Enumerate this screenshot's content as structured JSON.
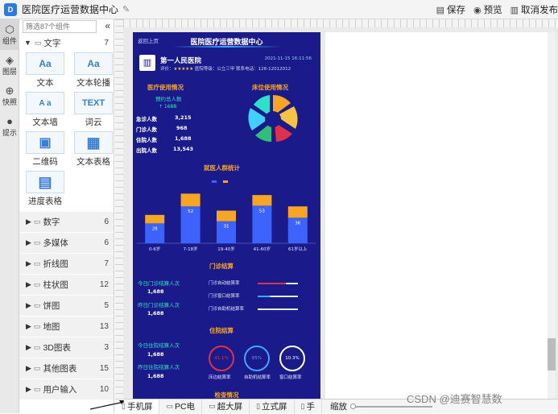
{
  "app": {
    "title": "医院医疗运营数据中心",
    "toolbar": {
      "save": "保存",
      "preview": "预览",
      "cancel_publish": "取消发布"
    }
  },
  "rail": [
    {
      "label": "组件",
      "icon": "cube-icon"
    },
    {
      "label": "图层",
      "icon": "layers-icon"
    },
    {
      "label": "快照",
      "icon": "snapshot-icon"
    },
    {
      "label": "提示",
      "icon": "bulb-icon"
    }
  ],
  "panel": {
    "search_placeholder": "筛选87个组件",
    "text_group": {
      "label": "文字",
      "count": "7"
    },
    "tiles": [
      {
        "label": "文本",
        "glyph": "Aa"
      },
      {
        "label": "文本轮播",
        "glyph": "Aa"
      },
      {
        "label": "文本墙",
        "glyph": "A a"
      },
      {
        "label": "词云",
        "glyph": "TEXT"
      },
      {
        "label": "二维码",
        "glyph": "▣"
      },
      {
        "label": "文本表格",
        "glyph": "▦"
      },
      {
        "label": "进度表格",
        "glyph": "▤"
      }
    ],
    "categories": [
      {
        "label": "数字",
        "count": "6"
      },
      {
        "label": "多媒体",
        "count": "6"
      },
      {
        "label": "折线图",
        "count": "7"
      },
      {
        "label": "柱状图",
        "count": "12"
      },
      {
        "label": "饼图",
        "count": "5"
      },
      {
        "label": "地图",
        "count": "13"
      },
      {
        "label": "3D图表",
        "count": "3"
      },
      {
        "label": "其他图表",
        "count": "15"
      },
      {
        "label": "用户输入",
        "count": "10"
      }
    ]
  },
  "dashboard": {
    "back": "返回上页",
    "title": "医院医疗运营数据中心",
    "hospital_name": "第一人民医院",
    "rating_label": "评价：",
    "stars": "★★★★★",
    "meta_tail": "  医院等级：公立三甲  联系电话：128-12012012",
    "datetime": "2021-11-15 16:11:56",
    "usage_title": "医疗使用情况",
    "appointment_label": "预约总人数",
    "appointment_value": "↑ 1688",
    "stats": [
      {
        "label": "急诊人数",
        "value": "3,215"
      },
      {
        "label": "门诊人数",
        "value": "968"
      },
      {
        "label": "住院人数",
        "value": "1,688"
      },
      {
        "label": "出院人数",
        "value": "13,543"
      }
    ],
    "bed_title": "床位使用情况",
    "crowd_title": "就医人群统计",
    "clinic_title": "门诊结算",
    "clinic_left": [
      {
        "label": "今日门诊结算人次",
        "value": "1,688"
      },
      {
        "label": "昨日门诊结算人次",
        "value": "1,688"
      }
    ],
    "clinic_bars": [
      {
        "label": "门诊自动结算率",
        "value": 0.7,
        "color": "#e0314b"
      },
      {
        "label": "门诊窗口结算率",
        "value": 0.3,
        "color": "#3fa6ff"
      },
      {
        "label": "门诊自助机结算率",
        "value": 0.1,
        "color": "#ffffff"
      }
    ],
    "inpatient_title": "住院结算",
    "inpatient_left": [
      {
        "label": "今日住院结算人次",
        "value": "1,688"
      },
      {
        "label": "昨日住院结算人次",
        "value": "1,688"
      }
    ],
    "rings": [
      {
        "label": "床边结算率",
        "value": "41.1%",
        "color": "#e0314b"
      },
      {
        "label": "自助机结算率",
        "value": "85%",
        "color": "#3fa6ff"
      },
      {
        "label": "窗口结算率",
        "value": "10.3%",
        "color": "#ffffff"
      }
    ],
    "check_title": "检查情况"
  },
  "chart_data": {
    "type": "bar",
    "categories": [
      "0-6岁",
      "7-18岁",
      "19-40岁",
      "41-60岁",
      "61岁以上"
    ],
    "series": [
      {
        "values": [
          28,
          52,
          31,
          53,
          36
        ],
        "color": "#3d63ff"
      },
      {
        "values": [
          12,
          18,
          15,
          15,
          16
        ],
        "color": "#f6a623"
      }
    ],
    "data_labels": [
      "28",
      "52",
      "31",
      "53",
      "36"
    ],
    "ylim": [
      0,
      75
    ],
    "grid": false,
    "legend": "top-center"
  },
  "bottombar": {
    "tabs": [
      "手机屏",
      "PC电",
      "超大屏",
      "立式屏",
      "手"
    ],
    "zoom_label": "缩放"
  },
  "watermark": "CSDN @迪赛智慧数"
}
